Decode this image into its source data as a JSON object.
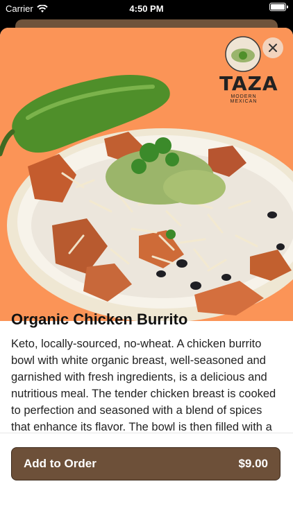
{
  "status_bar": {
    "carrier": "Carrier",
    "time": "4:50 PM"
  },
  "brand": {
    "name": "TAZA",
    "tagline": "MODERN MEXICAN"
  },
  "product": {
    "title": "Organic Chicken Burrito",
    "description": "Keto, locally-sourced, no-wheat. A chicken burrito bowl with white organic breast, well-seasoned and garnished with fresh ingredients, is a delicious and nutritious meal. The tender chicken breast is cooked to perfection and seasoned with a blend of spices that enhance its flavor. The bowl is then filled with a variety of fresh ingredients"
  },
  "order": {
    "label": "Add to Order",
    "price": "$9.00"
  },
  "colors": {
    "hero_bg": "#fb9457",
    "button_bg": "#6d5039"
  }
}
